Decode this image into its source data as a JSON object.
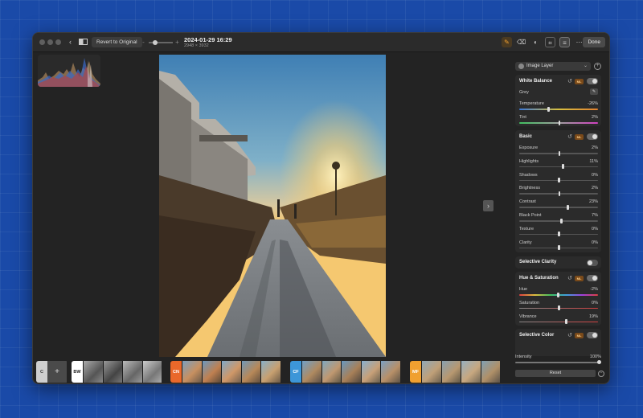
{
  "window": {
    "revert_label": "Revert to Original",
    "date": "2024-01-29 16:29",
    "dimensions": "2948 × 3932",
    "done_label": "Done"
  },
  "filmstrip": [
    {
      "badge": "C",
      "color": "#cfcfcf",
      "text_color": "#333"
    },
    {
      "badge": "BW",
      "color": "#ffffff",
      "text_color": "#222"
    },
    {
      "badge": "CN",
      "color": "#e9682a",
      "text_color": "#fff"
    },
    {
      "badge": "CF",
      "color": "#3d96d8",
      "text_color": "#fff"
    },
    {
      "badge": "MF",
      "color": "#f0a030",
      "text_color": "#fff"
    }
  ],
  "panel": {
    "layer": "Image Layer",
    "white_balance": {
      "title": "White Balance",
      "ml": "ML",
      "grey_label": "Grey",
      "temperature": {
        "label": "Temperature",
        "value": "-26%",
        "level": -0.26
      },
      "tint": {
        "label": "Tint",
        "value": "2%",
        "level": 0.02
      }
    },
    "basic": {
      "title": "Basic",
      "ml": "ML",
      "sliders": [
        {
          "label": "Exposure",
          "value": "2%",
          "level": 0.02
        },
        {
          "label": "Highlights",
          "value": "11%",
          "level": 0.11
        },
        {
          "label": "Shadows",
          "value": "0%",
          "level": 0
        },
        {
          "label": "Brightness",
          "value": "2%",
          "level": 0.02
        },
        {
          "label": "Contrast",
          "value": "23%",
          "level": 0.23
        },
        {
          "label": "Black Point",
          "value": "7%",
          "level": 0.07
        },
        {
          "label": "Texture",
          "value": "0%",
          "level": 0
        },
        {
          "label": "Clarity",
          "value": "0%",
          "level": 0
        }
      ]
    },
    "selective_clarity": {
      "title": "Selective Clarity"
    },
    "hue_saturation": {
      "title": "Hue & Saturation",
      "ml": "ML",
      "sliders": [
        {
          "label": "Hue",
          "value": "-2%",
          "level": -0.02
        },
        {
          "label": "Saturation",
          "value": "0%",
          "level": 0
        },
        {
          "label": "Vibrance",
          "value": "19%",
          "level": 0.19
        }
      ]
    },
    "selective_color": {
      "title": "Selective Color",
      "ml": "ML"
    },
    "intensity": {
      "label": "Intensity",
      "value": "100%",
      "level": 1.0
    },
    "reset_label": "Reset"
  }
}
